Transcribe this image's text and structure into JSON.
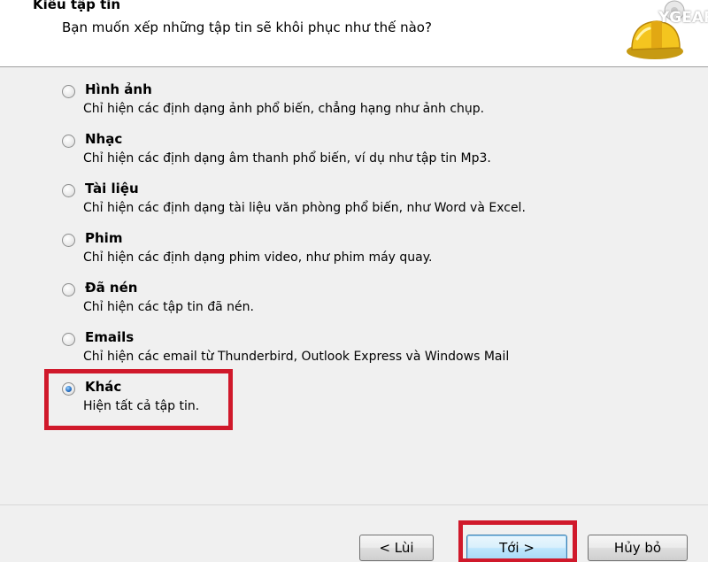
{
  "header": {
    "title": "Kiểu tập tin",
    "subtitle": "Bạn muốn xếp những tập tin sẽ khôi phục như thế nào?",
    "watermark": "YGEAR"
  },
  "options": [
    {
      "label": "Hình ảnh",
      "description": "Chỉ hiện các định dạng ảnh phổ biến, chẳng hạng như ảnh chụp.",
      "checked": false
    },
    {
      "label": "Nhạc",
      "description": "Chỉ hiện các định dạng âm thanh phổ biến, ví dụ như tập tin Mp3.",
      "checked": false
    },
    {
      "label": "Tài liệu",
      "description": "Chỉ hiện các định dạng tài liệu văn phòng phổ biến, như Word và Excel.",
      "checked": false
    },
    {
      "label": "Phim",
      "description": "Chỉ hiện các định dạng phim video, như phim máy quay.",
      "checked": false
    },
    {
      "label": "Đã nén",
      "description": "Chỉ hiện các tập tin đã nén.",
      "checked": false
    },
    {
      "label": "Emails",
      "description": "Chỉ hiện các email từ Thunderbird, Outlook Express và Windows Mail",
      "checked": false
    },
    {
      "label": "Khác",
      "description": "Hiện tất cả tập tin.",
      "checked": true
    }
  ],
  "buttons": {
    "back": "< Lùi",
    "next": "Tới >",
    "cancel": "Hủy bỏ"
  },
  "colors": {
    "highlight": "#d0192b",
    "radio_selected": "#2a73c6"
  }
}
